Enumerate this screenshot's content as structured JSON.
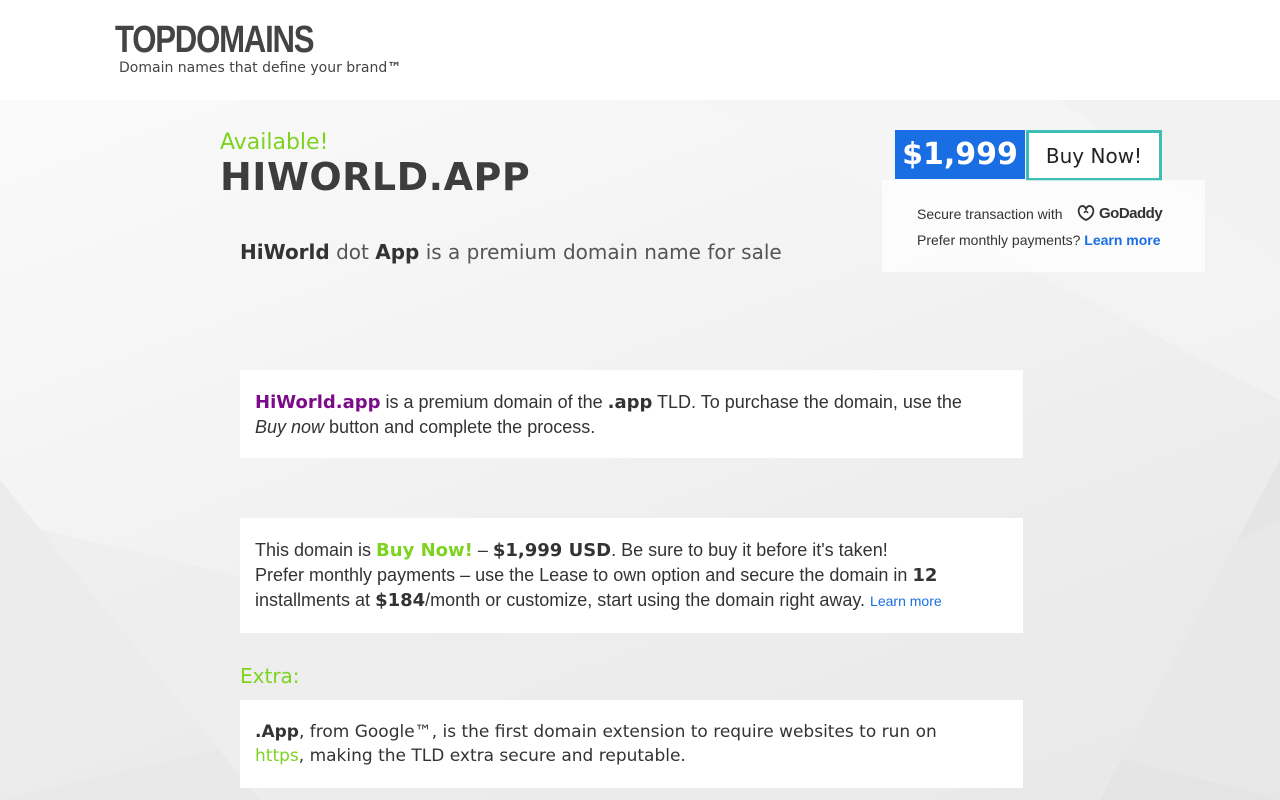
{
  "header": {
    "logo": "TOPDOMAINS",
    "tagline": "Domain names that define your brand",
    "tagline_tm": "™"
  },
  "hero": {
    "available": "Available!",
    "domain": "HIWORLD.APP",
    "subtitle_part1": "HiWorld",
    "subtitle_part2": " dot ",
    "subtitle_part3": "App",
    "subtitle_part4": " is a premium domain name for sale"
  },
  "purchase": {
    "price": "$1,999",
    "buy_label": "Buy Now!",
    "secure_text": "Secure transaction with",
    "godaddy": "GoDaddy",
    "monthly_text": "Prefer monthly payments?",
    "learn_more": "Learn more"
  },
  "card1": {
    "domain": "HiWorld.app",
    "text1": " is a premium domain of the ",
    "tld": ".app",
    "text2": " TLD. To purchase the domain, use the ",
    "buy_now_italic": "Buy now",
    "text3": " button and complete the process."
  },
  "card2": {
    "text1": "This domain is ",
    "buy_now": "Buy Now!",
    "dash": " – ",
    "price": "$1,999 USD",
    "text2": ". Be sure to buy it before it's taken!",
    "text3": "Prefer monthly payments – use the Lease to own option and secure the domain in ",
    "installments": "12",
    "text4": " installments at ",
    "monthly": "$184",
    "text5": "/month or customize, start using the domain right away. ",
    "learn_more": "Learn more"
  },
  "extra": {
    "label": "Extra:",
    "tld": ".App",
    "text1": ", from ",
    "google": "Google™",
    "text2": ", is the first domain extension to require websites to run on ",
    "https": "https",
    "text3": ", making the TLD extra secure and reputable."
  },
  "colors": {
    "accent_green": "#7ed321",
    "price_blue": "#1a6ee3",
    "button_border": "#3dbdb5",
    "domain_purple": "#7b0b8a"
  }
}
